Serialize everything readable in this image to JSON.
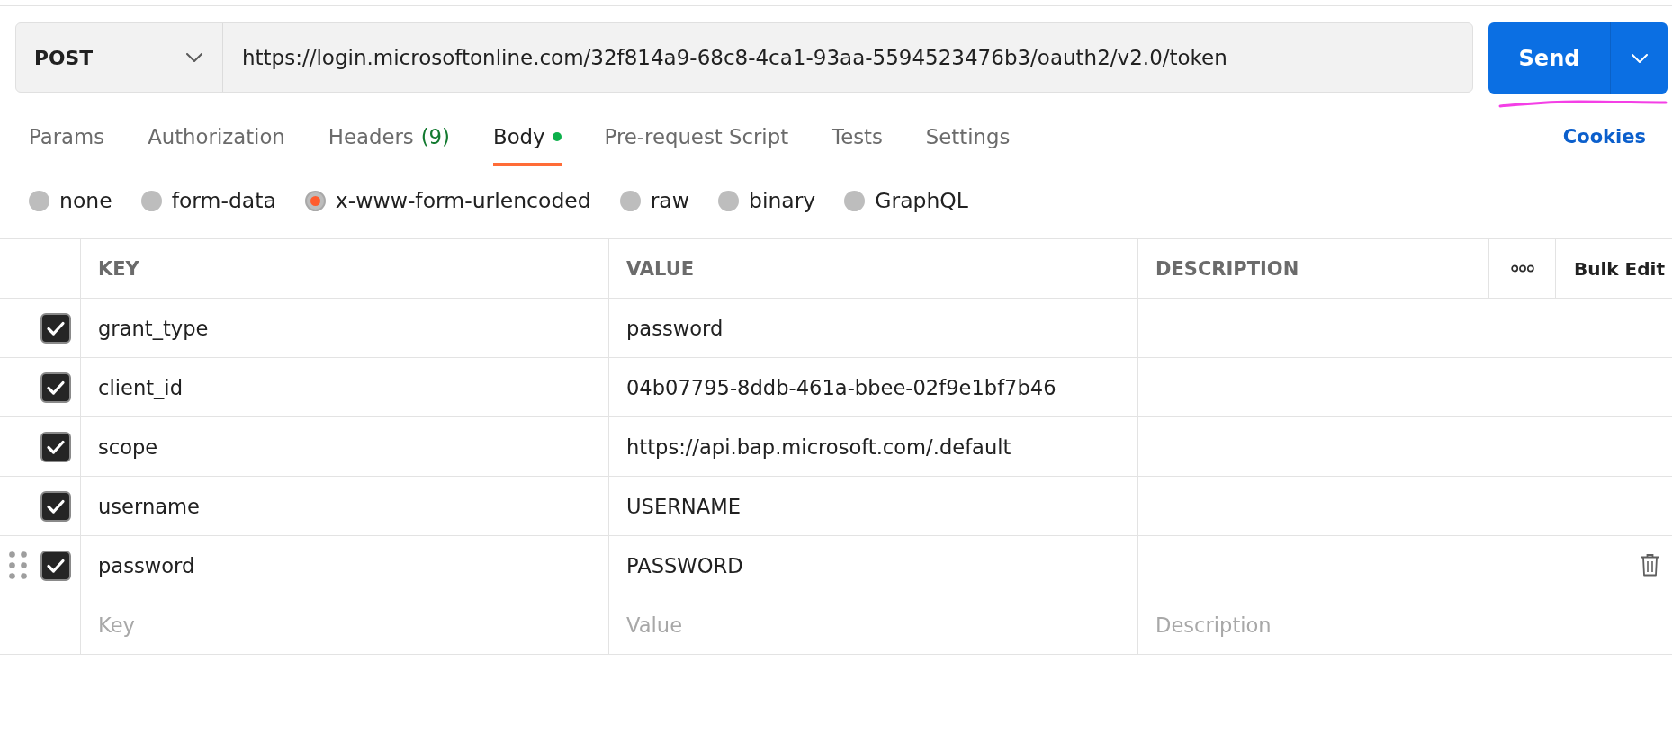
{
  "request": {
    "method": "POST",
    "url": "https://login.microsoftonline.com/32f814a9-68c8-4ca1-93aa-5594523476b3/oauth2/v2.0/token",
    "send_label": "Send"
  },
  "tabs": [
    {
      "label": "Params",
      "selected": false,
      "has_content": false
    },
    {
      "label": "Authorization",
      "selected": false,
      "has_content": false
    },
    {
      "label": "Headers",
      "count": "(9)",
      "selected": false,
      "has_content": false
    },
    {
      "label": "Body",
      "selected": true,
      "has_content": true
    },
    {
      "label": "Pre-request Script",
      "selected": false,
      "has_content": false
    },
    {
      "label": "Tests",
      "selected": false,
      "has_content": false
    },
    {
      "label": "Settings",
      "selected": false,
      "has_content": false
    }
  ],
  "cookies_link": "Cookies",
  "body_types": [
    {
      "label": "none",
      "selected": false
    },
    {
      "label": "form-data",
      "selected": false
    },
    {
      "label": "x-www-form-urlencoded",
      "selected": true
    },
    {
      "label": "raw",
      "selected": false
    },
    {
      "label": "binary",
      "selected": false
    },
    {
      "label": "GraphQL",
      "selected": false
    }
  ],
  "table": {
    "columns": [
      {
        "label": "KEY"
      },
      {
        "label": "VALUE"
      },
      {
        "label": "DESCRIPTION"
      }
    ],
    "bulk_edit": "Bulk Edit",
    "rows": [
      {
        "key": "grant_type",
        "value": "password",
        "checked": true,
        "hovered": false
      },
      {
        "key": "client_id",
        "value": "04b07795-8ddb-461a-bbee-02f9e1bf7b46",
        "checked": true,
        "hovered": false
      },
      {
        "key": "scope",
        "value": "https://api.bap.microsoft.com/.default",
        "checked": true,
        "hovered": false
      },
      {
        "key": "username",
        "value": "USERNAME",
        "checked": true,
        "hovered": false
      },
      {
        "key": "password",
        "value": "PASSWORD",
        "checked": true,
        "hovered": true
      }
    ],
    "new_row": {
      "key_placeholder": "Key",
      "value_placeholder": "Value",
      "description_placeholder": "Description"
    }
  }
}
